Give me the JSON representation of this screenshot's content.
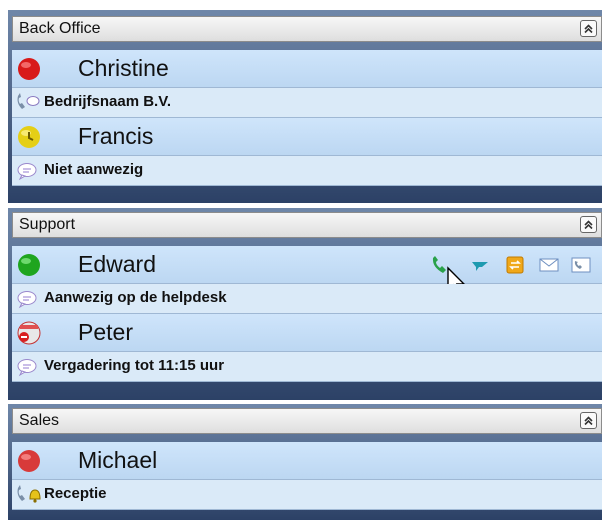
{
  "groups": [
    {
      "title": "Back Office",
      "contacts": [
        {
          "name": "Christine",
          "status": "Bedrijfsnaam B.V.",
          "presence": "busy",
          "status_icon": "phone-chat-icon"
        },
        {
          "name": "Francis",
          "status": "Niet aanwezig",
          "presence": "away",
          "status_icon": "chat-bubble-icon"
        }
      ]
    },
    {
      "title": "Support",
      "contacts": [
        {
          "name": "Edward",
          "status": "Aanwezig op de helpdesk",
          "presence": "available",
          "status_icon": "chat-bubble-icon"
        },
        {
          "name": "Peter",
          "status": "Vergadering tot 11:15 uur",
          "presence": "do-not-disturb",
          "status_icon": "chat-bubble-icon"
        }
      ]
    },
    {
      "title": "Sales",
      "contacts": [
        {
          "name": "Michael",
          "status": "Receptie",
          "presence": "busy",
          "status_icon": "phone-bell-icon"
        }
      ]
    }
  ],
  "actions": [
    "call-icon",
    "chat-icon",
    "transfer-icon",
    "email-icon",
    "voicemail-icon"
  ],
  "colors": {
    "available": "#1fa51f",
    "busy": "#d81a1a",
    "away": "#e5cf16",
    "dnd": "#e03030",
    "panel_bg": "#3d5478",
    "row_bg": "#c6ddf5"
  }
}
